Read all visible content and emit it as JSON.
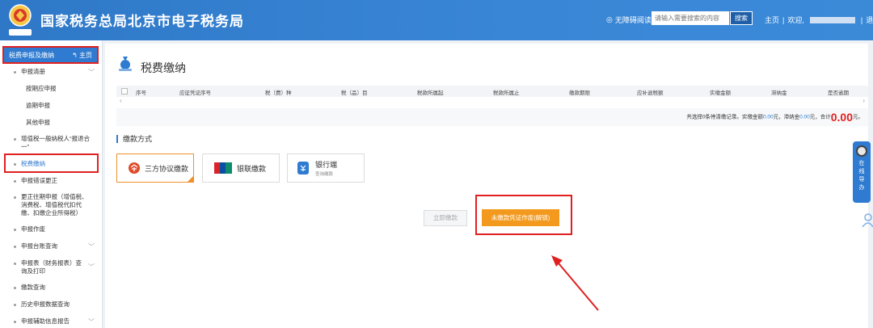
{
  "header": {
    "title": "国家税务总局北京市电子税务局",
    "accessible": "无障碍阅读",
    "search_placeholder": "请输入需要搜索的内容",
    "search_button": "搜索",
    "home": "主页",
    "welcome": "欢迎,",
    "logout": "退出",
    "emblem_text": "中国税务"
  },
  "sidebar": {
    "head_label": "税费申报及缴纳",
    "head_home": "主页",
    "items": [
      {
        "label": "申报清册"
      },
      {
        "label": "按期应申报"
      },
      {
        "label": "逾期申报"
      },
      {
        "label": "其他申报"
      },
      {
        "label": "增值税一般纳税人“报退合一”"
      },
      {
        "label": "税费缴纳"
      },
      {
        "label": "申报错误更正"
      },
      {
        "label": "更正往期申报（增值税、消费税、增值税代扣代缴、扣缴企业所得税）"
      },
      {
        "label": "申报作废"
      },
      {
        "label": "申报台账查询"
      },
      {
        "label": "申报表（财务报表）查询及打印"
      },
      {
        "label": "缴款查询"
      },
      {
        "label": "历史申报数据查询"
      },
      {
        "label": "申报辅助信息报告"
      }
    ]
  },
  "main": {
    "title": "税费缴纳",
    "columns": [
      "序号",
      "应征凭证序号",
      "税（费）种",
      "税（品）目",
      "税款所属起",
      "税款所属止",
      "缴款期限",
      "应补退税额",
      "实缴金额",
      "滞纳金",
      "是否逾期"
    ],
    "summary": {
      "prefix": "共选择0条待清缴记录。实缴金额",
      "paid": "0.00",
      "mid1": "元，滞纳金",
      "late": "0.00",
      "mid2": "元，合计",
      "total": "0.00",
      "suffix": "元。"
    },
    "section_title": "缴款方式",
    "pay_options": {
      "three_party": "三方协议缴款",
      "unionpay": "银联缴款",
      "bank": "银行端",
      "bank_sub": "查询缴款"
    },
    "btn_pay_now": "立即缴款",
    "btn_unpaid": "未缴款凭证作废(解锁)"
  },
  "float_help": {
    "text": "在线导办"
  },
  "colors": {
    "primary": "#2f7bd1",
    "accent": "#f39a1e",
    "highlight": "#e02020"
  }
}
